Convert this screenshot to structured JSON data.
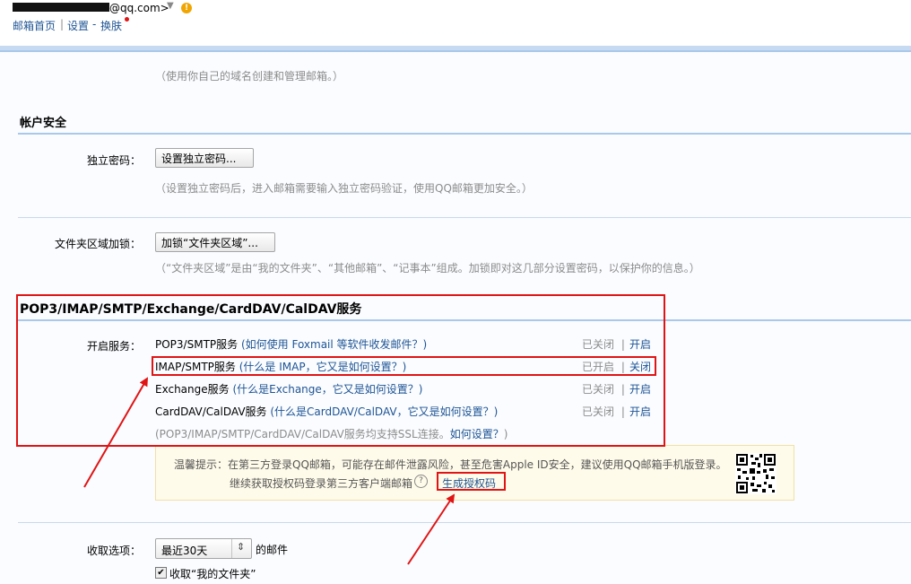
{
  "header": {
    "email_suffix": "@qq.com>",
    "nav_home": "邮箱首页",
    "nav_sep": "|",
    "nav_settings": "设置",
    "nav_dash": "-",
    "nav_skin": "换肤"
  },
  "domain_hint": "（使用你自己的域名创建和管理邮箱。）",
  "account_security": {
    "title": "帐户安全",
    "independent_password": {
      "label": "独立密码：",
      "button": "设置独立密码...",
      "hint": "（设置独立密码后，进入邮箱需要输入独立密码验证，使用QQ邮箱更加安全。）"
    },
    "folder_lock": {
      "label": "文件夹区域加锁：",
      "button": "加锁“文件夹区域”...",
      "hint": "（“文件夹区域”是由“我的文件夹”、“其他邮箱”、“记事本”组成。加锁即对这几部分设置密码，以保护你的信息。）"
    }
  },
  "services": {
    "title": "POP3/IMAP/SMTP/Exchange/CardDAV/CalDAV服务",
    "label": "开启服务：",
    "items": [
      {
        "name": "POP3/SMTP服务",
        "help": "(如何使用 Foxmail 等软件收发邮件？)",
        "status": "已关闭",
        "sep": "|",
        "action": "开启"
      },
      {
        "name": "IMAP/SMTP服务",
        "help": "(什么是 IMAP，它又是如何设置？)",
        "status": "已开启",
        "sep": "|",
        "action": "关闭"
      },
      {
        "name": "Exchange服务",
        "help": "(什么是Exchange，它又是如何设置？)",
        "status": "已关闭",
        "sep": "|",
        "action": "开启"
      },
      {
        "name": "CardDAV/CalDAV服务",
        "help": "(什么是CardDAV/CalDAV，它又是如何设置？)",
        "status": "已关闭",
        "sep": "|",
        "action": "开启"
      }
    ],
    "ssl_note": "(POP3/IMAP/SMTP/CardDAV/CalDAV服务均支持SSL连接。",
    "ssl_link": "如何设置？",
    "ssl_close": ")"
  },
  "notice": {
    "line1": "温馨提示：在第三方登录QQ邮箱，可能存在邮件泄露风险，甚至危害Apple ID安全，建议使用QQ邮箱手机版登录。",
    "line2": "继续获取授权码登录第三方客户端邮箱",
    "help_glyph": "?",
    "link": "生成授权码"
  },
  "receive": {
    "label": "收取选项：",
    "select_value": "最近30天",
    "after_select": "的邮件",
    "checkbox_label": "收取“我的文件夹”",
    "checkbox_checked": true
  },
  "colors": {
    "accent_link": "#1e5494",
    "annotation_red": "#e01414",
    "notice_bg": "#fffbea"
  }
}
